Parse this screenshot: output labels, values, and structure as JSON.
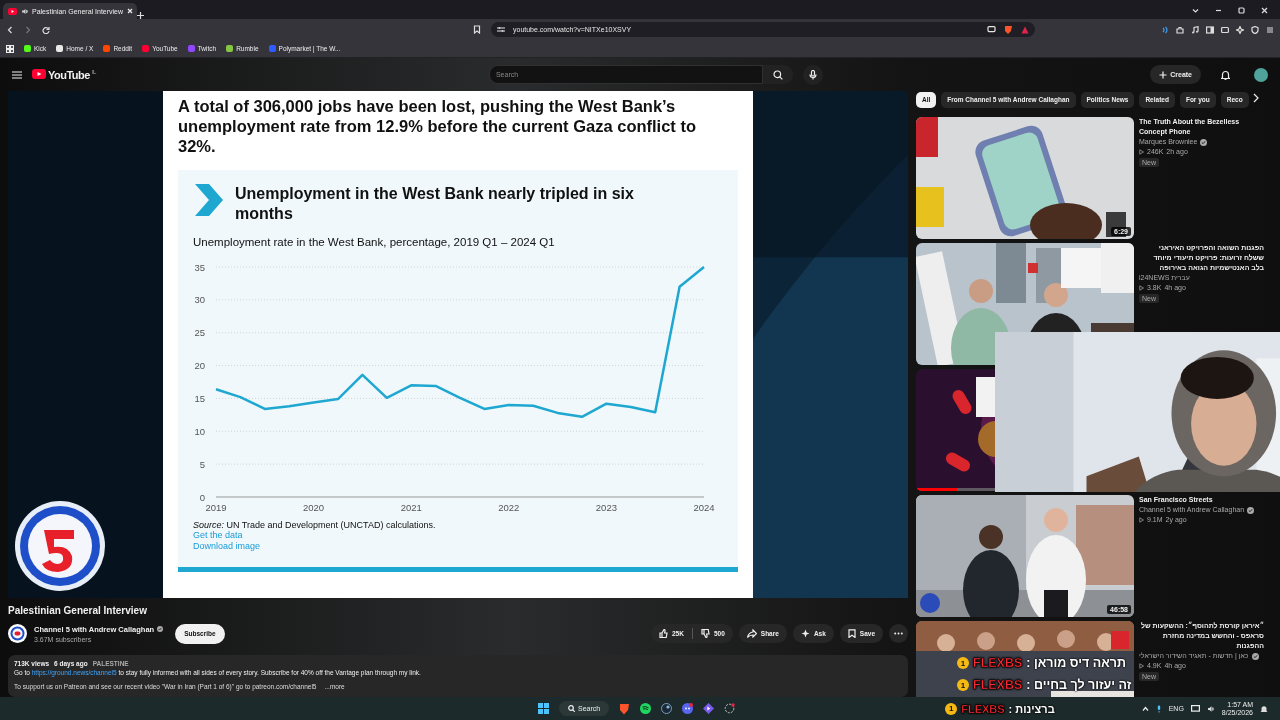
{
  "browser": {
    "tabs": [
      {
        "title": "Palestinian General Interview",
        "selected": true
      }
    ],
    "url": "youtube.com/watch?v=NITXe10XSVY",
    "bookmarks": [
      {
        "label": "Kick",
        "color": "#53fc18"
      },
      {
        "label": "Home / X",
        "color": "#e8e8e8"
      },
      {
        "label": "Reddit",
        "color": "#ff4500"
      },
      {
        "label": "YouTube",
        "color": "#ff0033"
      },
      {
        "label": "Twitch",
        "color": "#9146ff"
      },
      {
        "label": "Rumble",
        "color": "#85c742"
      },
      {
        "label": "Polymarket | The W...",
        "color": "#2e5cff"
      }
    ]
  },
  "youtube": {
    "logo": "YouTube",
    "region": "IL",
    "search": {
      "placeholder": "Search"
    },
    "create": "Create"
  },
  "chips": [
    {
      "label": "All",
      "selected": true
    },
    {
      "label": "From Channel 5 with Andrew Callaghan",
      "selected": false
    },
    {
      "label": "Politics News",
      "selected": false
    },
    {
      "label": "Related",
      "selected": false
    },
    {
      "label": "For you",
      "selected": false
    },
    {
      "label": "Reco",
      "selected": false
    }
  ],
  "slide": {
    "heading": "A total of 306,000 jobs have been lost, pushing the West Bank’s unemployment rate from 12.9% before the current Gaza conflict to 32%.",
    "card_title": "Unemployment in the West Bank nearly tripled in six months",
    "chart_data": {
      "type": "line",
      "title": "Unemployment rate in the West Bank, percentage, 2019 Q1 – 2024 Q1",
      "xlim": [
        2019,
        2024
      ],
      "ylim": [
        0,
        35
      ],
      "xticks": [
        2019,
        2020,
        2021,
        2022,
        2023,
        2024
      ],
      "yticks": [
        0,
        5,
        10,
        15,
        20,
        25,
        30,
        35
      ],
      "x": [
        2019,
        2019.25,
        2019.5,
        2019.75,
        2020,
        2020.25,
        2020.5,
        2020.75,
        2021,
        2021.25,
        2021.5,
        2021.75,
        2022,
        2022.25,
        2022.5,
        2022.75,
        2023,
        2023.25,
        2023.5,
        2023.75,
        2024
      ],
      "grid": true,
      "series": [
        {
          "color": "#1ea7d0",
          "values": [
            16.4,
            15.2,
            13.4,
            13.8,
            14.4,
            14.9,
            18.6,
            15.1,
            17.0,
            16.9,
            15.1,
            13.4,
            14.0,
            13.9,
            12.8,
            12.2,
            14.2,
            13.7,
            12.9,
            32.0,
            35.0
          ]
        }
      ]
    },
    "source": "*Source:* UN Trade and Development (UNCTAD) calculations.",
    "links": [
      "Get the data",
      "Download image"
    ]
  },
  "info": {
    "title": "Palestinian General Interview",
    "channel": "Channel 5 with Andrew Callaghan",
    "verified": true,
    "subscribers": "3.67M subscribers",
    "subscribe": "Subscribe",
    "likes": "25K",
    "dislikes": "500",
    "actions": [
      {
        "kind": "share",
        "label": "Share"
      },
      {
        "kind": "ask",
        "label": "Ask"
      },
      {
        "kind": "save",
        "label": "Save"
      }
    ],
    "description": {
      "views": "713K views",
      "age": "6 days ago",
      "tag": "PALESTINE",
      "before": "Go to ",
      "link": "https://ground.news/channel5",
      "after": " to stay fully informed with all sides of every story. Subscribe for 40% off the Vantage plan through my link.",
      "line2": "To support us on Patreon and see our recent video \"War in Iran (Part 1 of 6)\" go to patreon.com/channel5",
      "more": "...more"
    }
  },
  "recommendations": [
    {
      "kind": "video",
      "title": "The Truth About the Bezelless Concept Phone",
      "channel": "Marques Brownlee",
      "verified": true,
      "views": "246K",
      "age": "2h ago",
      "badge": "New",
      "duration": "6:29"
    },
    {
      "kind": "video",
      "title": "הפגנות השואה והפרויקט האיראני ששלח זרועות: פרויקט תיעודי מיוחד בלב האנטישמיות הגואה באירופה",
      "channel": "i24NEWS עברית",
      "views": "3.8K",
      "age": "4h ago",
      "badge": "New"
    },
    {
      "kind": "covered",
      "level": 0.19
    },
    {
      "kind": "video",
      "title": "San Francisco Streets",
      "channel": "Channel 5 with Andrew Callaghan",
      "verified": true,
      "views": "9.1M",
      "age": "2y ago",
      "duration": "46:58"
    },
    {
      "kind": "video",
      "title": "״איראן קורסת לתהוסף״: ההשקעות של סראפס - והחשש במדינה מחזרת ההפגנות",
      "channel": "כאן | חדשות - תאגיד השידור הישראלי",
      "verified": true,
      "views": "4.9K",
      "age": "4h ago",
      "badge": "New"
    }
  ],
  "overlay_messages": [
    {
      "badge": "1",
      "user": "FLEXBS",
      "text": ": תראה דיס מוראן"
    },
    {
      "badge": "1",
      "user": "FLEXBS",
      "text": ": זה יעזור לך בחיים"
    }
  ],
  "taskbar": {
    "search": "Search",
    "message": {
      "badge": "1",
      "user": "FLEXBS",
      "text": ": ברצינות"
    },
    "lang": "ENG",
    "time": "1:57 AM",
    "date": "8/25/2026"
  }
}
